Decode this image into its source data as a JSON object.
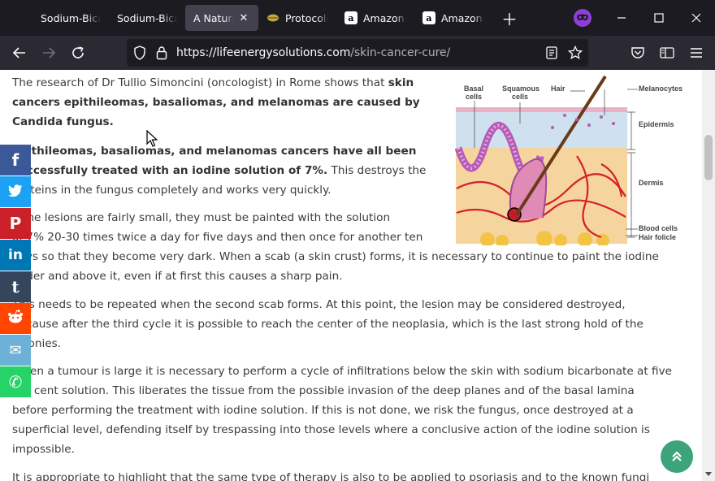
{
  "tabs": [
    {
      "label": "Sodium-Bicar",
      "favicon": "none",
      "active": false
    },
    {
      "label": "Sodium-Bicar",
      "favicon": "none",
      "active": false
    },
    {
      "label": "A Natural S",
      "favicon": "none",
      "active": true
    },
    {
      "label": "Protocols",
      "favicon": "leaf-icon",
      "active": false
    },
    {
      "label": "Amazon.c",
      "favicon": "amazon-icon",
      "active": false
    },
    {
      "label": "Amazon.c",
      "favicon": "amazon-icon",
      "active": false
    }
  ],
  "amazon_glyph": "a",
  "url": {
    "host": "https://lifeenergysolutions.com",
    "path": "/skin-cancer-cure/"
  },
  "article": {
    "p1_normal": "The research of Dr Tullio Simoncini (oncologist) in Rome shows that ",
    "p1_bold_a": "skin",
    "p1_bold_b": "cancers epithileomas, basaliomas, and melanomas are caused by",
    "p1_bold_c": "Candida fungus.",
    "p2_bold_a": "Epithileomas, basaliomas, and melanomas cancers have all been",
    "p2_bold_b": "successfully treated with an iodine solution of 7%.",
    "p2_normal_a": " This destroys the",
    "p2_normal_b": "proteins in the fungus completely and works very quickly.",
    "p3_a": "If the lesions are fairly small, they must be painted with the solution",
    "p3_b": "of 7% 20-30 times twice a day for five days and then once for another ten",
    "p3_c": "days so that they become very dark. When a scab (a skin crust) forms, it is necessary to continue to paint the iodine",
    "p3_d": "under and above it, even if at first this causes a sharp pain.",
    "p4_a": "This needs to be repeated when the second scab forms. At this point, the lesion may be considered destroyed,",
    "p4_b": "because after the third cycle it is possible to reach the center of the neoplasia, which is the last strong hold of the",
    "p4_c": "colonies.",
    "p5_a": "When a tumour is large it is necessary to perform a cycle of infiltrations below the skin with sodium bicarbonate at five",
    "p5_b": "per cent solution. This liberates the tissue from the possible invasion of the deep planes and of the basal lamina",
    "p5_c": "before performing the treatment with iodine solution. If this is not done, we risk the fungus, once destroyed at a",
    "p5_d": "superficial level, defending itself by trespassing into those levels where a conclusive action of the iodine solution is",
    "p5_e": "impossible.",
    "p6_a": "It is appropriate to highlight that the same type of therapy is also to be applied to psoriasis and to the known fungi"
  },
  "figure": {
    "labels": {
      "basal": "Basal",
      "basal2": "cells",
      "squamous": "Squamous",
      "squamous2": "cells",
      "hair": "Hair",
      "melanocytes": "Melanocytes",
      "epidermis": "Epidermis",
      "dermis": "Dermis",
      "blood": "Blood cells",
      "follicle": "Hair folicle"
    }
  },
  "social": [
    {
      "name": "facebook",
      "glyph": "f",
      "color": "#3b5998"
    },
    {
      "name": "twitter",
      "glyph": "t",
      "color": "#1da1f2"
    },
    {
      "name": "pinterest",
      "glyph": "P",
      "color": "#cb2027"
    },
    {
      "name": "linkedin",
      "glyph": "in",
      "color": "#0077b5"
    },
    {
      "name": "tumblr",
      "glyph": "t",
      "color": "#35465c"
    },
    {
      "name": "reddit",
      "glyph": "r",
      "color": "#ff4500"
    },
    {
      "name": "email",
      "glyph": "✉",
      "color": "#6eb1d8"
    },
    {
      "name": "whatsapp",
      "glyph": "✆",
      "color": "#25d366"
    }
  ],
  "colors": {
    "accent": "#3da37a",
    "tabbar": "#1c1b22",
    "navbar": "#2b2a33"
  }
}
